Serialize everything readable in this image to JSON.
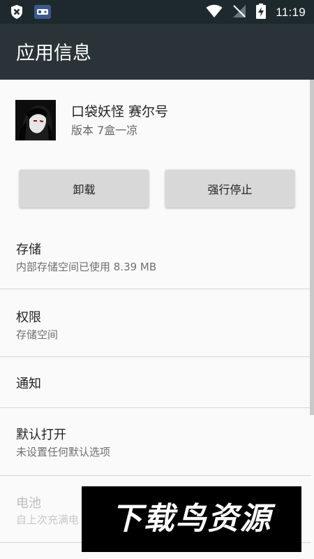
{
  "status_bar": {
    "time": "11:19",
    "icons": [
      "shield-x-icon",
      "gamepad-app-icon",
      "wifi-icon",
      "signal-off-icon",
      "battery-charging-icon"
    ]
  },
  "app_bar": {
    "title": "应用信息"
  },
  "app": {
    "name": "口袋妖怪 赛尔号",
    "version": "版本 7盒一凉"
  },
  "buttons": {
    "uninstall": "卸载",
    "force_stop": "强行停止"
  },
  "list": {
    "storage": {
      "title": "存储",
      "subtitle": "内部存储空间已使用 8.39 MB"
    },
    "permissions": {
      "title": "权限",
      "subtitle": "存储空间"
    },
    "notifications": {
      "title": "通知"
    },
    "open_by_default": {
      "title": "默认打开",
      "subtitle": "未设置任何默认选项"
    },
    "battery": {
      "title": "电池",
      "subtitle": "自上次充满电"
    }
  },
  "watermark": {
    "text": "下载鸟资源"
  },
  "colors": {
    "status_bar": "#1e292e",
    "app_bar": "#2a3438",
    "background": "#fafafa",
    "button": "#d8d8d8"
  }
}
